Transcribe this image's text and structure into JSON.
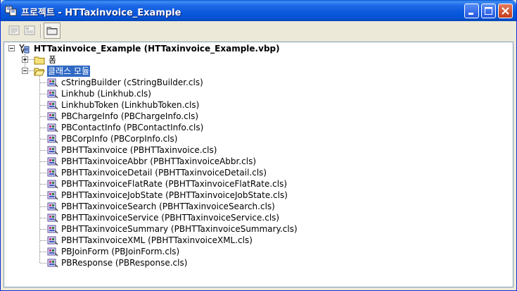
{
  "window": {
    "title": "프로젝트 - HTTaxinvoice_Example"
  },
  "colors": {
    "titlebar": "#0a58dc",
    "selection": "#316ac5",
    "close_button": "#c33c1c"
  },
  "toolbar": {
    "buttons": [
      {
        "icon": "view-code-icon"
      },
      {
        "icon": "view-object-icon"
      },
      {
        "icon": "toggle-folders-icon"
      }
    ]
  },
  "tree": {
    "root": {
      "label": "HTTaxinvoice_Example (HTTaxinvoice_Example.vbp)",
      "icon": "vb-project-icon",
      "expanded": true
    },
    "folders": [
      {
        "label": "폼",
        "icon": "folder-icon",
        "expanded": false,
        "selected": false
      },
      {
        "label": "클래스 모듈",
        "icon": "open-folder-icon",
        "expanded": true,
        "selected": true
      }
    ],
    "class_modules": [
      {
        "label": "cStringBuilder (cStringBuilder.cls)"
      },
      {
        "label": "Linkhub (Linkhub.cls)"
      },
      {
        "label": "LinkhubToken (LinkhubToken.cls)"
      },
      {
        "label": "PBChargeInfo (PBChargeInfo.cls)"
      },
      {
        "label": "PBContactInfo (PBContactInfo.cls)"
      },
      {
        "label": "PBCorpInfo (PBCorpInfo.cls)"
      },
      {
        "label": "PBHTTaxinvoice (PBHTTaxinvoice.cls)"
      },
      {
        "label": "PBHTTaxinvoiceAbbr (PBHTTaxinvoiceAbbr.cls)"
      },
      {
        "label": "PBHTTaxinvoiceDetail (PBHTTaxinvoiceDetail.cls)"
      },
      {
        "label": "PBHTTaxinvoiceFlatRate (PBHTTaxinvoiceFlatRate.cls)"
      },
      {
        "label": "PBHTTaxinvoiceJobState (PBHTTaxinvoiceJobState.cls)"
      },
      {
        "label": "PBHTTaxinvoiceSearch (PBHTTaxinvoiceSearch.cls)"
      },
      {
        "label": "PBHTTaxinvoiceService (PBHTTaxinvoiceService.cls)"
      },
      {
        "label": "PBHTTaxinvoiceSummary (PBHTTaxinvoiceSummary.cls)"
      },
      {
        "label": "PBHTTaxinvoiceXML (PBHTTaxinvoiceXML.cls)"
      },
      {
        "label": "PBJoinForm (PBJoinForm.cls)"
      },
      {
        "label": "PBResponse (PBResponse.cls)"
      }
    ]
  }
}
